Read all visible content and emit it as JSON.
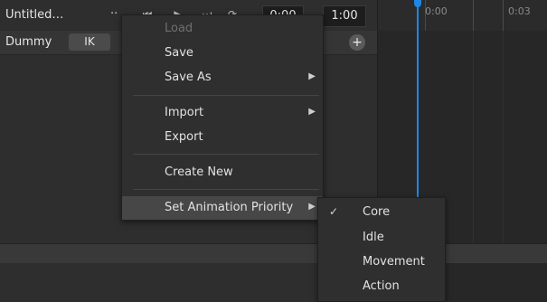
{
  "toolbar": {
    "title": "Untitled…",
    "more": "··",
    "time_current": "0:00",
    "time_separator": "/",
    "time_total": "1:00",
    "icons": [
      "skip-back-icon",
      "play-icon",
      "skip-forward-icon",
      "loop-icon"
    ]
  },
  "rig": {
    "name": "Dummy",
    "ik_label": "IK",
    "add_label": "+"
  },
  "timeline": {
    "ticks": [
      "0:00",
      "0:03"
    ],
    "playhead_color": "#1e86e6"
  },
  "menu": {
    "items": [
      {
        "label": "Load",
        "disabled": true
      },
      {
        "label": "Save"
      },
      {
        "label": "Save As",
        "submenu": true
      },
      {
        "label": "Import",
        "submenu": true
      },
      {
        "label": "Export"
      },
      {
        "label": "Create New"
      },
      {
        "label": "Set Animation Priority",
        "submenu": true,
        "highlighted": true
      }
    ],
    "arrow": "▶"
  },
  "priority_menu": {
    "check": "✓",
    "items": [
      {
        "label": "Core",
        "checked": true
      },
      {
        "label": "Idle"
      },
      {
        "label": "Movement"
      },
      {
        "label": "Action"
      }
    ]
  }
}
